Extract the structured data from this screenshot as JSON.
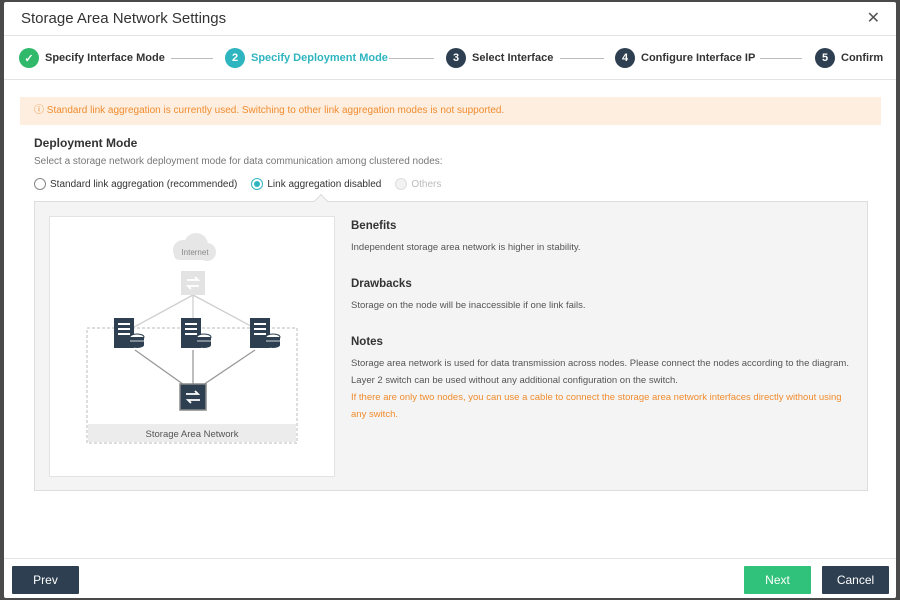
{
  "dialog": {
    "title": "Storage Area Network Settings"
  },
  "steps": [
    {
      "num": "✓",
      "label": "Specify Interface Mode",
      "state": "done"
    },
    {
      "num": "2",
      "label": "Specify Deployment Mode",
      "state": "active"
    },
    {
      "num": "3",
      "label": "Select Interface",
      "state": "pending"
    },
    {
      "num": "4",
      "label": "Configure Interface IP",
      "state": "pending"
    },
    {
      "num": "5",
      "label": "Confirm",
      "state": "pending"
    }
  ],
  "notice": {
    "icon": "info-circle-icon",
    "text": "ⓘ  Standard link aggregation is currently used. Switching to other link aggregation modes is not supported."
  },
  "deployment": {
    "title": "Deployment Mode",
    "description": "Select a storage network deployment mode for data communication among clustered nodes:",
    "options": [
      {
        "label": "Standard link aggregation (recommended)",
        "checked": false,
        "disabled": false
      },
      {
        "label": "Link aggregation disabled",
        "checked": true,
        "disabled": false
      },
      {
        "label": "Others",
        "checked": false,
        "disabled": true
      }
    ]
  },
  "diagram": {
    "internet_label": "Internet",
    "network_label": "Storage Area Network"
  },
  "info": {
    "benefits_title": "Benefits",
    "benefits_text": "Independent storage area network is higher in stability.",
    "drawbacks_title": "Drawbacks",
    "drawbacks_text": "Storage on the node will be inaccessible if one link fails.",
    "notes_title": "Notes",
    "notes_line1": "Storage area network is used for data transmission across nodes. Please connect the nodes according to the diagram.",
    "notes_line2": "Layer 2 switch can be used without any additional configuration on the switch.",
    "notes_warn": "If there are only two nodes, you can use a cable to connect the storage area network interfaces directly without using any switch."
  },
  "footer": {
    "prev_label": "Prev",
    "next_label": "Next",
    "cancel_label": "Cancel"
  },
  "colors": {
    "accent": "#2fb5bf",
    "success": "#30b86b",
    "dark": "#2d3f50",
    "warning": "#f08c2e"
  }
}
